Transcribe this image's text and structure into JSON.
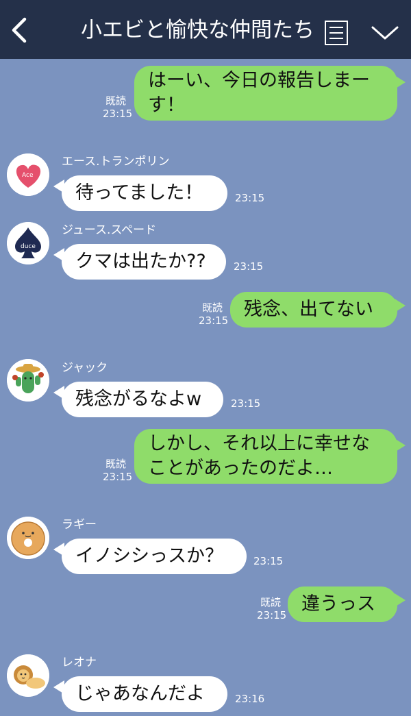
{
  "header": {
    "back_icon": "chevron-left-icon",
    "title": "小エビと愉快な仲間たち",
    "menu_icon": "menu-icon",
    "dropdown_icon": "chevron-down-icon"
  },
  "colors": {
    "header_bg": "#243049",
    "chat_bg": "#7b93bf",
    "outgoing_bubble": "#8fdc6a",
    "incoming_bubble": "#ffffff"
  },
  "messages": [
    {
      "direction": "out",
      "lines": [
        "はーい、今日の報告しまー",
        "す！"
      ],
      "read": "既読",
      "time": "23:15"
    },
    {
      "direction": "in",
      "sender": "エース.トランポリン",
      "avatar": "heart-ace-avatar",
      "avatar_text": "Ace",
      "lines": [
        "待ってました！"
      ],
      "time": "23:15"
    },
    {
      "direction": "in",
      "sender": "ジュース.スペード",
      "avatar": "spade-duce-avatar",
      "avatar_text": "duce",
      "lines": [
        "クマは出たか??"
      ],
      "time": "23:15"
    },
    {
      "direction": "out",
      "lines": [
        "残念、出てない"
      ],
      "read": "既読",
      "time": "23:15"
    },
    {
      "direction": "in",
      "sender": "ジャック",
      "avatar": "cactus-avatar",
      "lines": [
        "残念がるなよw"
      ],
      "time": "23:15"
    },
    {
      "direction": "out",
      "lines": [
        "しかし、それ以上に幸せな",
        "ことがあったのだよ…"
      ],
      "read": "既読",
      "time": "23:15"
    },
    {
      "direction": "in",
      "sender": "ラギー",
      "avatar": "donut-avatar",
      "lines": [
        "イノシシっスか？"
      ],
      "time": "23:15"
    },
    {
      "direction": "out",
      "lines": [
        "違うっス"
      ],
      "read": "既読",
      "time": "23:15"
    },
    {
      "direction": "in",
      "sender": "レオナ",
      "avatar": "lion-avatar",
      "lines": [
        "じゃあなんだよ"
      ],
      "time": "23:16"
    }
  ]
}
